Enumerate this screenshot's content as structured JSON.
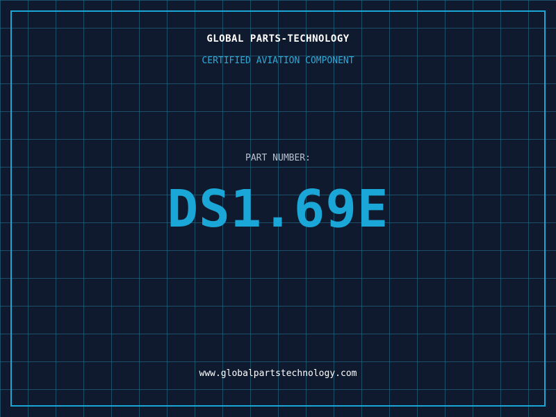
{
  "header": {
    "company": "GLOBAL PARTS-TECHNOLOGY",
    "subtitle": "CERTIFIED AVIATION COMPONENT"
  },
  "part": {
    "label": "PART NUMBER:",
    "number": "DS1.69E"
  },
  "footer": {
    "url": "www.globalpartstechnology.com"
  },
  "colors": {
    "background": "#101a2e",
    "accent": "#1aa6d6",
    "grid": "#287896"
  }
}
